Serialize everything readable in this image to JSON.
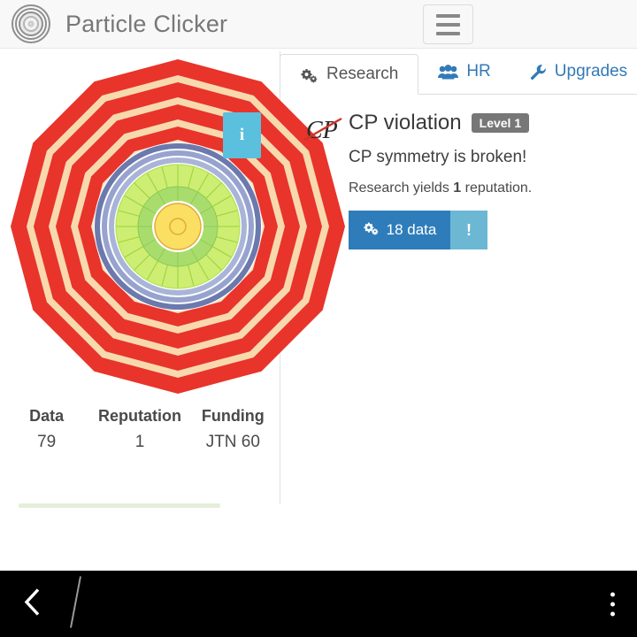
{
  "header": {
    "title": "Particle Clicker",
    "logo_icon": "detector-rings-logo",
    "menu_icon": "hamburger-icon"
  },
  "detector": {
    "info_button_label": "i",
    "info_icon": "info-icon"
  },
  "stats": [
    {
      "label": "Data",
      "value": "79"
    },
    {
      "label": "Reputation",
      "value": "1"
    },
    {
      "label": "Funding",
      "value": "JTN 60"
    }
  ],
  "progress": {
    "percent": 100
  },
  "tabs": [
    {
      "label": "Research",
      "icon": "gears-icon",
      "active": true
    },
    {
      "label": "HR",
      "icon": "users-icon",
      "active": false
    },
    {
      "label": "Upgrades",
      "icon": "wrench-icon",
      "active": false
    }
  ],
  "research": {
    "icon": "cp-violation-icon",
    "icon_text": "CP",
    "title": "CP violation",
    "level_badge": "Level 1",
    "description": "CP symmetry is broken!",
    "yield_prefix": "Research yields ",
    "yield_value": "1",
    "yield_suffix": " reputation.",
    "buy_icon": "gears-icon",
    "buy_label": "18 data",
    "warn_label": "!",
    "warn_icon": "exclamation-icon"
  },
  "sysnav": {
    "back_icon": "back-chevron-icon",
    "home_icon": "home-slash-icon",
    "more_icon": "overflow-menu-icon"
  },
  "colors": {
    "accent_blue": "#337ab7",
    "button_blue": "#2e7dba",
    "info_blue": "#5bc0de",
    "badge_gray": "#777777",
    "detector_red": "#e8342a",
    "detector_peach": "#f8d9ae"
  }
}
